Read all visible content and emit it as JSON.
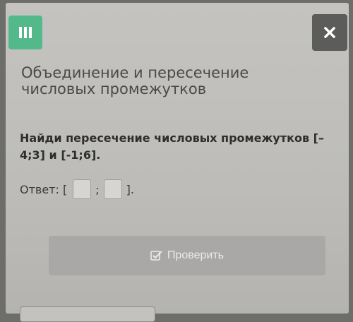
{
  "header": {
    "menu_icon": "hamburger-icon",
    "close_icon": "close-icon",
    "accent_color": "#54b98a"
  },
  "lesson": {
    "title": "Объединение и пересечение числовых промежутков"
  },
  "task": {
    "question": "Найди пересечение числовых промежутков [–4;3] и [-1;6].",
    "answer_prefix": "Ответ: [",
    "separator": ";",
    "answer_suffix": "].",
    "answer_left_value": "",
    "answer_right_value": ""
  },
  "actions": {
    "check_label": "Проверить",
    "check_icon": "checkbox-icon"
  }
}
